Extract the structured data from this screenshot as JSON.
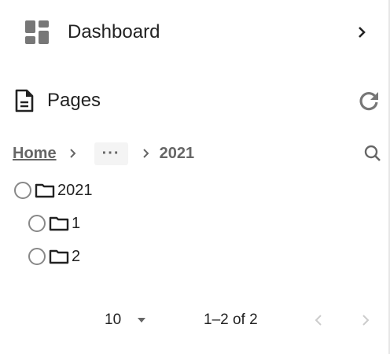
{
  "nav": {
    "dashboard_label": "Dashboard"
  },
  "pages": {
    "title": "Pages"
  },
  "breadcrumb": {
    "home": "Home",
    "ellipsis": "···",
    "current": "2021"
  },
  "tree": [
    {
      "label": "2021",
      "level": 0
    },
    {
      "label": "1",
      "level": 1
    },
    {
      "label": "2",
      "level": 1
    }
  ],
  "pagination": {
    "page_size": "10",
    "range": "1–2 of 2"
  }
}
